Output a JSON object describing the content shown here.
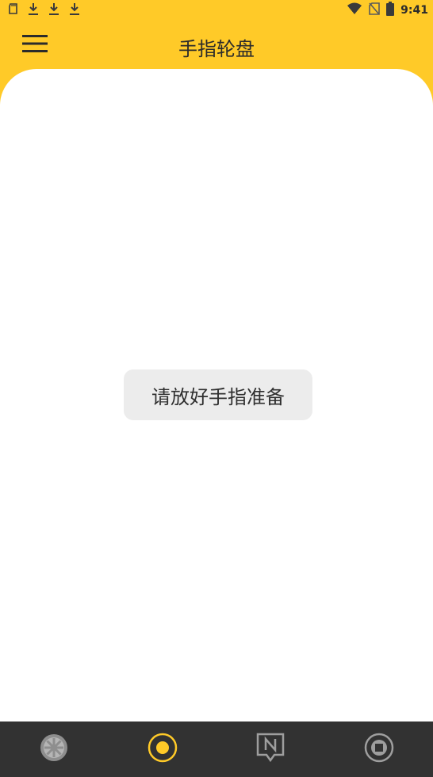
{
  "status_bar": {
    "time": "9:41",
    "left_icons": [
      "sd-card-icon",
      "download-icon",
      "download-icon",
      "download-icon"
    ],
    "right_icons": [
      "wifi-icon",
      "no-sim-icon",
      "battery-icon"
    ]
  },
  "app_bar": {
    "title": "手指轮盘",
    "menu_icon": "hamburger-menu-icon"
  },
  "main": {
    "toast_text": "请放好手指准备"
  },
  "bottom_nav": {
    "items": [
      {
        "icon": "wheel-icon",
        "active": false
      },
      {
        "icon": "finger-record-icon",
        "active": true
      },
      {
        "icon": "notice-icon",
        "active": false
      },
      {
        "icon": "settings-ring-icon",
        "active": false
      }
    ]
  },
  "colors": {
    "accent": "#FFCA28",
    "nav_bg": "#323232",
    "toast_bg": "#ECECEC",
    "inactive_icon": "#9E9E9E",
    "active_icon": "#FFCA28"
  }
}
